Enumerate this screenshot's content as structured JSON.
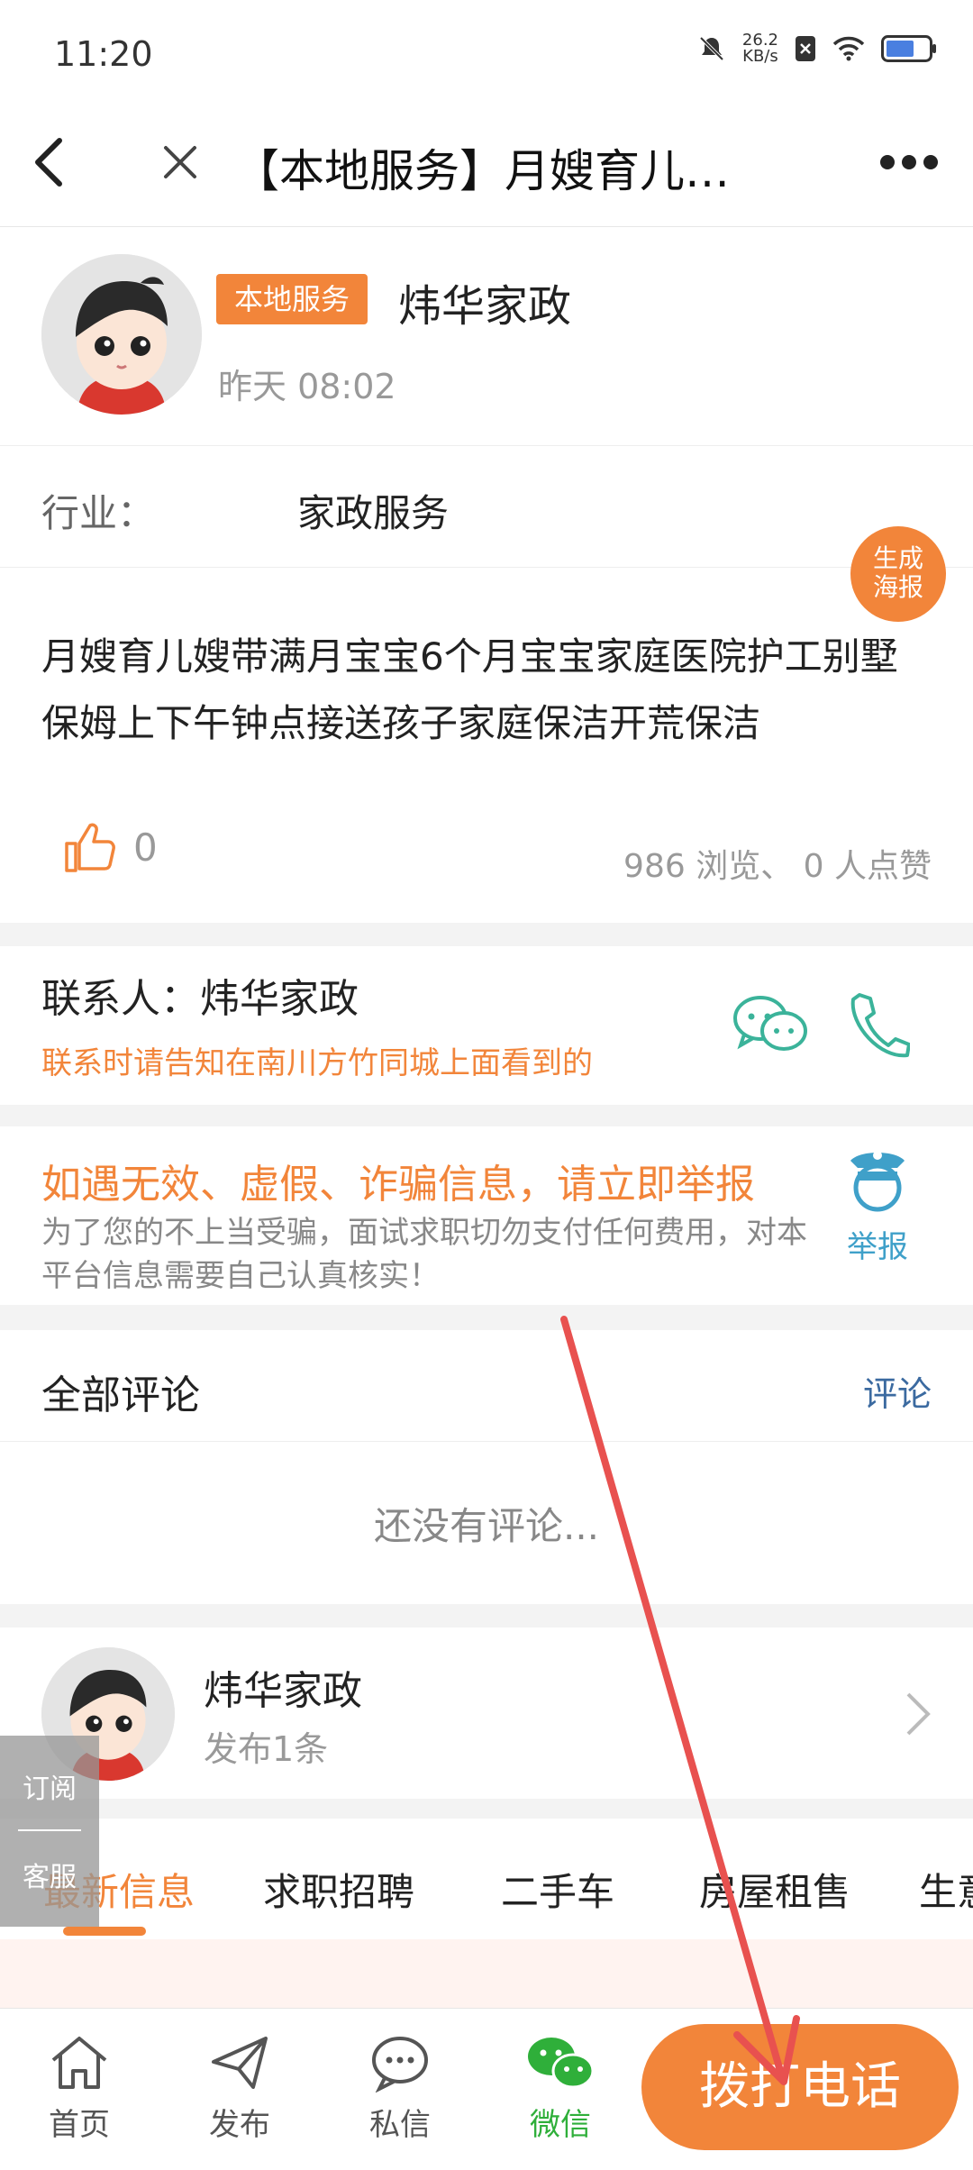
{
  "status_bar": {
    "time": "11:20",
    "speed_value": "26.2",
    "speed_unit": "KB/s"
  },
  "nav": {
    "title": "【本地服务】月嫂育儿…"
  },
  "post": {
    "tag": "本地服务",
    "poster_name": "炜华家政",
    "posted_time": "昨天 08:02",
    "industry_label": "行业：",
    "industry_value": "家政服务",
    "poster_button_line1": "生成",
    "poster_button_line2": "海报",
    "description": "月嫂育儿嫂带满月宝宝6个月宝宝家庭医院护工别墅保姆上下午钟点接送孩子家庭保洁开荒保洁",
    "like_count": "0",
    "views_text": "986 浏览、 0 人点赞"
  },
  "contact": {
    "name_line": "联系人：炜华家政",
    "tip": "联系时请告知在南川方竹同城上面看到的"
  },
  "report": {
    "title": "如遇无效、虚假、诈骗信息，请立即举报",
    "description": "为了您的不上当受骗，面试求职切勿支付任何费用，对本平台信息需要自己认真核实！",
    "label": "举报"
  },
  "comments": {
    "title": "全部评论",
    "link": "评论",
    "empty_text": "还没有评论..."
  },
  "publisher": {
    "name": "炜华家政",
    "count": "发布1条"
  },
  "tabs": [
    {
      "label": "最新信息"
    },
    {
      "label": "求职招聘"
    },
    {
      "label": "二手车"
    },
    {
      "label": "房屋租售"
    },
    {
      "label": "生意"
    }
  ],
  "float_buttons": {
    "subscribe": "订阅",
    "service": "客服"
  },
  "bottom_bar": {
    "items": [
      {
        "label": "首页",
        "icon": "home-icon"
      },
      {
        "label": "发布",
        "icon": "send-icon"
      },
      {
        "label": "私信",
        "icon": "chat-icon"
      },
      {
        "label": "微信",
        "icon": "wechat-icon"
      }
    ],
    "call_label": "拨打电话"
  },
  "colors": {
    "accent": "#f2853a",
    "wechat_green": "#2faf3a",
    "teal": "#3bb39a",
    "annotation_arrow": "#e8514f"
  }
}
